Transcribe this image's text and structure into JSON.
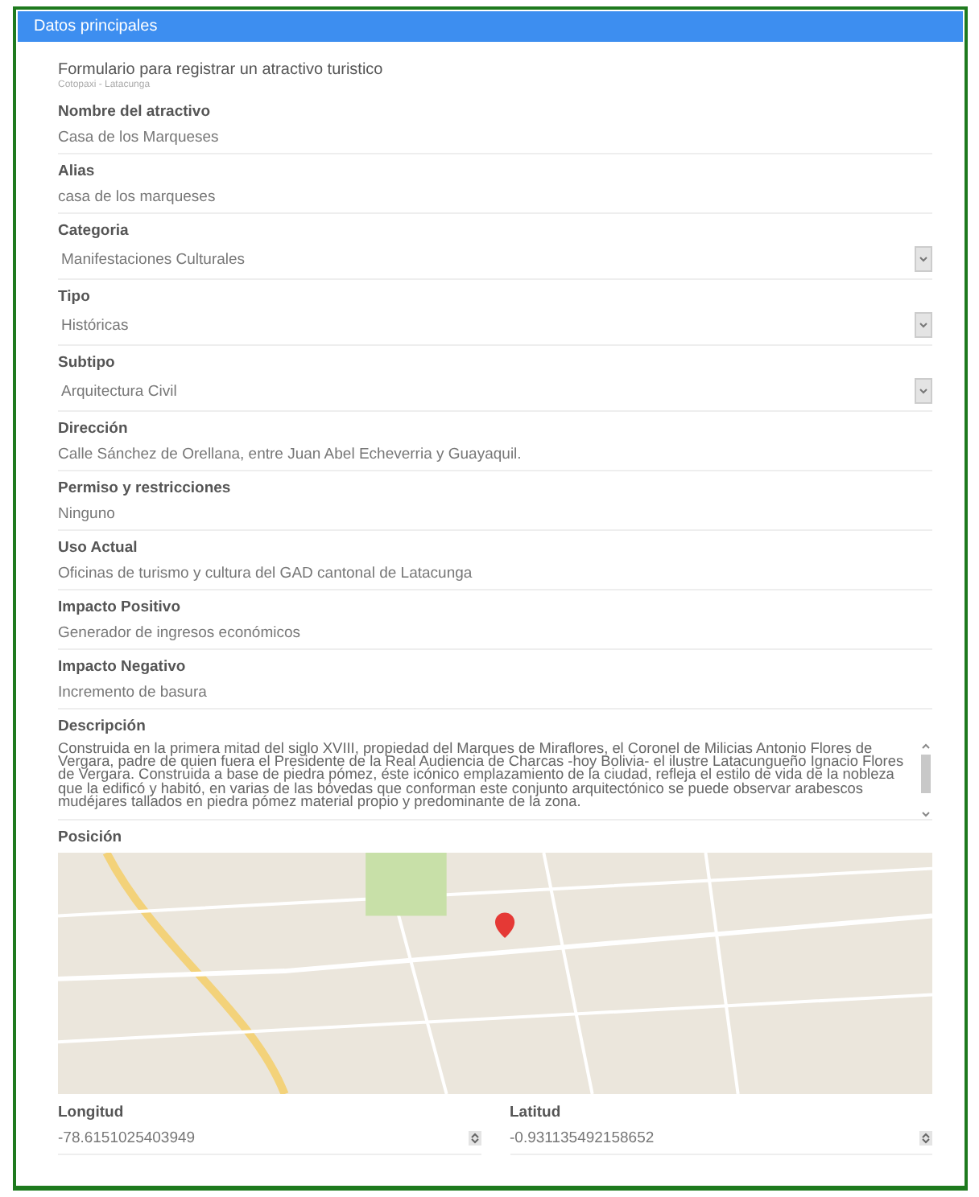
{
  "panel": {
    "title": "Datos principales"
  },
  "form": {
    "title": "Formulario para registrar un atractivo turistico",
    "subtitle": "Cotopaxi - Latacunga"
  },
  "fields": [
    {
      "kind": "text",
      "label": "Nombre del atractivo",
      "value": "Casa de los Marqueses"
    },
    {
      "kind": "text",
      "label": "Alias",
      "value": "casa de los marqueses"
    },
    {
      "kind": "select",
      "label": "Categoria",
      "value": "Manifestaciones Culturales"
    },
    {
      "kind": "select",
      "label": "Tipo",
      "value": "Históricas"
    },
    {
      "kind": "select",
      "label": "Subtipo",
      "value": "Arquitectura Civil"
    },
    {
      "kind": "text",
      "label": "Dirección",
      "value": "Calle Sánchez de Orellana, entre Juan Abel Echeverria y Guayaquil."
    },
    {
      "kind": "text",
      "label": "Permiso y restricciones",
      "value": "Ninguno"
    },
    {
      "kind": "text",
      "label": "Uso Actual",
      "value": "Oficinas de turismo y cultura del GAD cantonal de Latacunga"
    },
    {
      "kind": "text",
      "label": "Impacto Positivo",
      "value": "Generador de ingresos económicos"
    },
    {
      "kind": "text",
      "label": "Impacto Negativo",
      "value": "Incremento de basura"
    },
    {
      "kind": "textarea",
      "label": "Descripción",
      "value": "Construida en la primera mitad del siglo XVIII, propiedad del Marques de Miraflores, el Coronel de Milicias Antonio Flores de Vergara, padre de quien fuera el Presidente de la Real Audiencia de Charcas -hoy Bolivia- el ilustre Latacungueño Ignacio Flores de Vergara. Construida a base de piedra pómez, éste icónico emplazamiento de la ciudad, refleja el estilo de vida de la nobleza que la edificó y habitó, en varias de las bóvedas que conforman este conjunto arquitectónico se puede observar arabescos mudéjares tallados en piedra pómez material propio y predominante de la zona."
    }
  ],
  "position": {
    "label": "Posición"
  },
  "coordinates": [
    {
      "label": "Longitud",
      "value": "-78.6151025403949"
    },
    {
      "label": "Latitud",
      "value": "-0.931135492158652"
    }
  ]
}
